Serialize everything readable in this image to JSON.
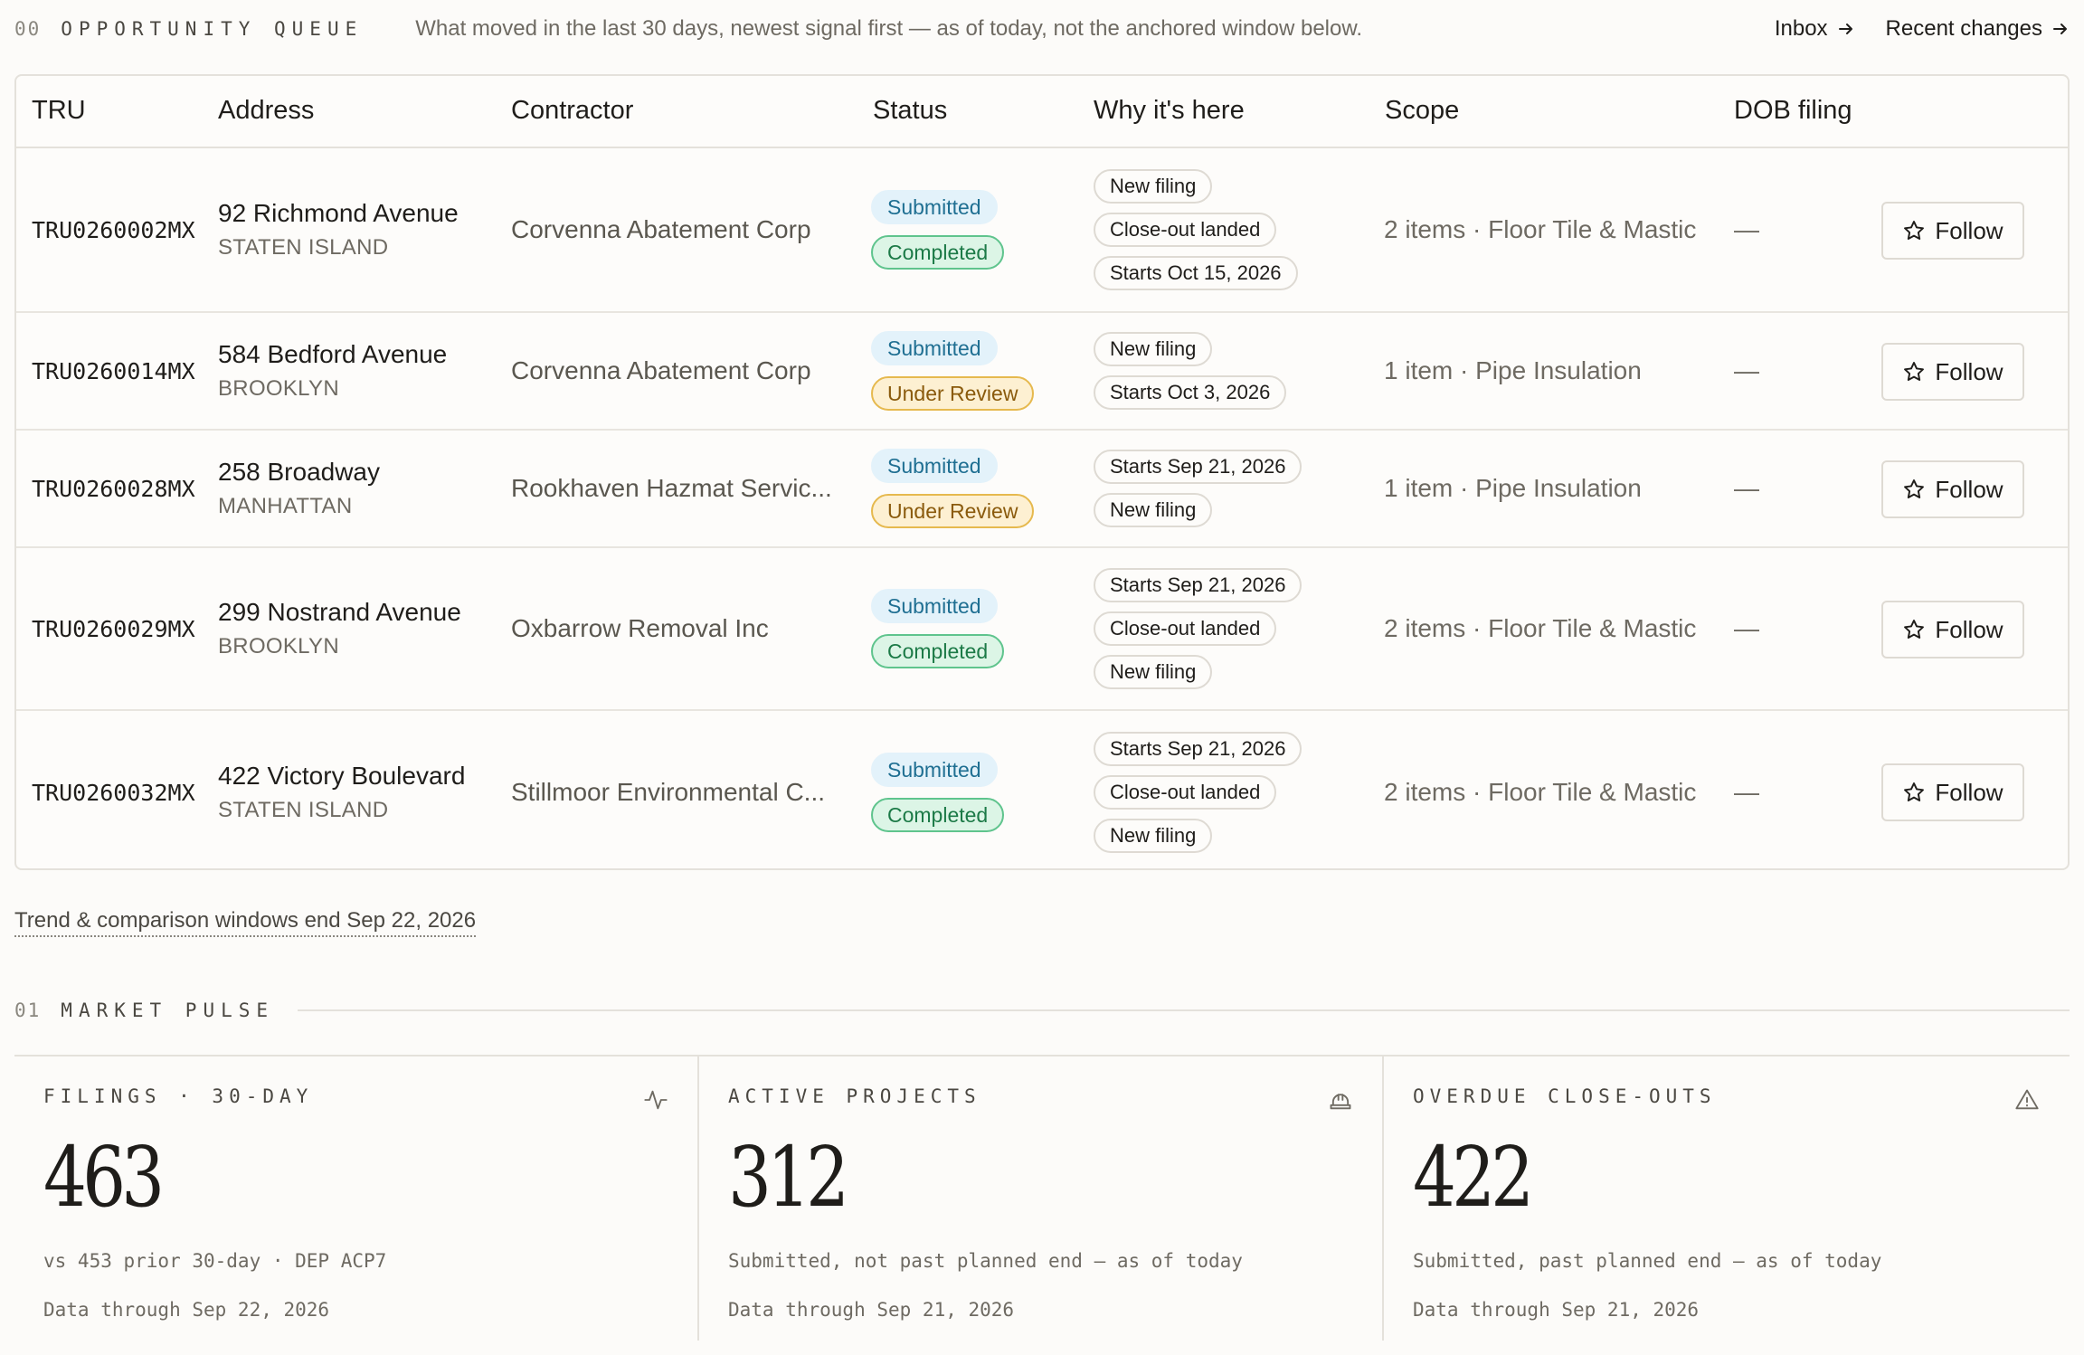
{
  "queue": {
    "num": "00",
    "title": "OPPORTUNITY QUEUE",
    "description": "What moved in the last 30 days, newest signal first — as of today, not the anchored window below.",
    "links": [
      {
        "label": "Inbox"
      },
      {
        "label": "Recent changes"
      }
    ]
  },
  "table": {
    "headers": [
      "TRU",
      "Address",
      "Contractor",
      "Status",
      "Why it's here",
      "Scope",
      "DOB filing"
    ],
    "follow_label": "Follow",
    "rows": [
      {
        "tru": "TRU0260002MX",
        "address": "92 Richmond Avenue",
        "borough": "STATEN ISLAND",
        "contractor": "Corvenna Abatement Corp",
        "statuses": [
          "Submitted",
          "Completed"
        ],
        "why": [
          "New filing",
          "Close-out landed",
          "Starts Oct 15, 2026"
        ],
        "scope": "2 items · Floor Tile & Mastic",
        "dob": "—"
      },
      {
        "tru": "TRU0260014MX",
        "address": "584 Bedford Avenue",
        "borough": "BROOKLYN",
        "contractor": "Corvenna Abatement Corp",
        "statuses": [
          "Submitted",
          "Under Review"
        ],
        "why": [
          "New filing",
          "Starts Oct 3, 2026"
        ],
        "scope": "1 item · Pipe Insulation",
        "dob": "—"
      },
      {
        "tru": "TRU0260028MX",
        "address": "258 Broadway",
        "borough": "MANHATTAN",
        "contractor": "Rookhaven Hazmat Servic...",
        "statuses": [
          "Submitted",
          "Under Review"
        ],
        "why": [
          "Starts Sep 21, 2026",
          "New filing"
        ],
        "scope": "1 item · Pipe Insulation",
        "dob": "—"
      },
      {
        "tru": "TRU0260029MX",
        "address": "299 Nostrand Avenue",
        "borough": "BROOKLYN",
        "contractor": "Oxbarrow Removal Inc",
        "statuses": [
          "Submitted",
          "Completed"
        ],
        "why": [
          "Starts Sep 21, 2026",
          "Close-out landed",
          "New filing"
        ],
        "scope": "2 items · Floor Tile & Mastic",
        "dob": "—"
      },
      {
        "tru": "TRU0260032MX",
        "address": "422 Victory Boulevard",
        "borough": "STATEN ISLAND",
        "contractor": "Stillmoor Environmental C...",
        "statuses": [
          "Submitted",
          "Completed"
        ],
        "why": [
          "Starts Sep 21, 2026",
          "Close-out landed",
          "New filing"
        ],
        "scope": "2 items · Floor Tile & Mastic",
        "dob": "—"
      }
    ]
  },
  "status_colors": {
    "Submitted": {
      "bg": "#e3f2fa",
      "border": "#e3f2fa",
      "fg": "#1f6f92"
    },
    "Completed": {
      "bg": "#dcf5e6",
      "border": "#5fc48d",
      "fg": "#1c7a47"
    },
    "Under Review": {
      "bg": "#fdf0d2",
      "border": "#e6b94e",
      "fg": "#8a5a0c"
    }
  },
  "trend_link": "Trend & comparison windows end Sep 22, 2026",
  "pulse": {
    "num": "01",
    "title": "MARKET PULSE",
    "stats": [
      {
        "label": "FILINGS · 30-DAY",
        "icon": "activity-icon",
        "value": "463",
        "sub": "vs 453 prior 30-day · DEP ACP7",
        "date": "Data through Sep 22, 2026"
      },
      {
        "label": "ACTIVE PROJECTS",
        "icon": "hard-hat-icon",
        "value": "312",
        "sub": "Submitted, not past planned end — as of today",
        "date": "Data through Sep 21, 2026"
      },
      {
        "label": "OVERDUE CLOSE-OUTS",
        "icon": "warning-icon",
        "value": "422",
        "sub": "Submitted, past planned end — as of today",
        "date": "Data through Sep 21, 2026"
      }
    ]
  }
}
